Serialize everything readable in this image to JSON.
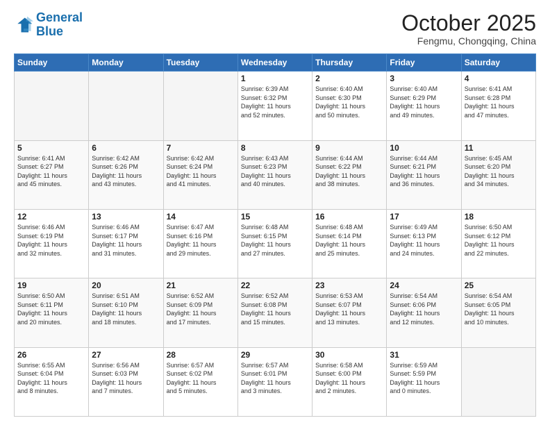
{
  "logo": {
    "line1": "General",
    "line2": "Blue"
  },
  "title": "October 2025",
  "subtitle": "Fengmu, Chongqing, China",
  "days_header": [
    "Sunday",
    "Monday",
    "Tuesday",
    "Wednesday",
    "Thursday",
    "Friday",
    "Saturday"
  ],
  "weeks": [
    [
      {
        "day": "",
        "info": ""
      },
      {
        "day": "",
        "info": ""
      },
      {
        "day": "",
        "info": ""
      },
      {
        "day": "1",
        "info": "Sunrise: 6:39 AM\nSunset: 6:32 PM\nDaylight: 11 hours\nand 52 minutes."
      },
      {
        "day": "2",
        "info": "Sunrise: 6:40 AM\nSunset: 6:30 PM\nDaylight: 11 hours\nand 50 minutes."
      },
      {
        "day": "3",
        "info": "Sunrise: 6:40 AM\nSunset: 6:29 PM\nDaylight: 11 hours\nand 49 minutes."
      },
      {
        "day": "4",
        "info": "Sunrise: 6:41 AM\nSunset: 6:28 PM\nDaylight: 11 hours\nand 47 minutes."
      }
    ],
    [
      {
        "day": "5",
        "info": "Sunrise: 6:41 AM\nSunset: 6:27 PM\nDaylight: 11 hours\nand 45 minutes."
      },
      {
        "day": "6",
        "info": "Sunrise: 6:42 AM\nSunset: 6:26 PM\nDaylight: 11 hours\nand 43 minutes."
      },
      {
        "day": "7",
        "info": "Sunrise: 6:42 AM\nSunset: 6:24 PM\nDaylight: 11 hours\nand 41 minutes."
      },
      {
        "day": "8",
        "info": "Sunrise: 6:43 AM\nSunset: 6:23 PM\nDaylight: 11 hours\nand 40 minutes."
      },
      {
        "day": "9",
        "info": "Sunrise: 6:44 AM\nSunset: 6:22 PM\nDaylight: 11 hours\nand 38 minutes."
      },
      {
        "day": "10",
        "info": "Sunrise: 6:44 AM\nSunset: 6:21 PM\nDaylight: 11 hours\nand 36 minutes."
      },
      {
        "day": "11",
        "info": "Sunrise: 6:45 AM\nSunset: 6:20 PM\nDaylight: 11 hours\nand 34 minutes."
      }
    ],
    [
      {
        "day": "12",
        "info": "Sunrise: 6:46 AM\nSunset: 6:19 PM\nDaylight: 11 hours\nand 32 minutes."
      },
      {
        "day": "13",
        "info": "Sunrise: 6:46 AM\nSunset: 6:17 PM\nDaylight: 11 hours\nand 31 minutes."
      },
      {
        "day": "14",
        "info": "Sunrise: 6:47 AM\nSunset: 6:16 PM\nDaylight: 11 hours\nand 29 minutes."
      },
      {
        "day": "15",
        "info": "Sunrise: 6:48 AM\nSunset: 6:15 PM\nDaylight: 11 hours\nand 27 minutes."
      },
      {
        "day": "16",
        "info": "Sunrise: 6:48 AM\nSunset: 6:14 PM\nDaylight: 11 hours\nand 25 minutes."
      },
      {
        "day": "17",
        "info": "Sunrise: 6:49 AM\nSunset: 6:13 PM\nDaylight: 11 hours\nand 24 minutes."
      },
      {
        "day": "18",
        "info": "Sunrise: 6:50 AM\nSunset: 6:12 PM\nDaylight: 11 hours\nand 22 minutes."
      }
    ],
    [
      {
        "day": "19",
        "info": "Sunrise: 6:50 AM\nSunset: 6:11 PM\nDaylight: 11 hours\nand 20 minutes."
      },
      {
        "day": "20",
        "info": "Sunrise: 6:51 AM\nSunset: 6:10 PM\nDaylight: 11 hours\nand 18 minutes."
      },
      {
        "day": "21",
        "info": "Sunrise: 6:52 AM\nSunset: 6:09 PM\nDaylight: 11 hours\nand 17 minutes."
      },
      {
        "day": "22",
        "info": "Sunrise: 6:52 AM\nSunset: 6:08 PM\nDaylight: 11 hours\nand 15 minutes."
      },
      {
        "day": "23",
        "info": "Sunrise: 6:53 AM\nSunset: 6:07 PM\nDaylight: 11 hours\nand 13 minutes."
      },
      {
        "day": "24",
        "info": "Sunrise: 6:54 AM\nSunset: 6:06 PM\nDaylight: 11 hours\nand 12 minutes."
      },
      {
        "day": "25",
        "info": "Sunrise: 6:54 AM\nSunset: 6:05 PM\nDaylight: 11 hours\nand 10 minutes."
      }
    ],
    [
      {
        "day": "26",
        "info": "Sunrise: 6:55 AM\nSunset: 6:04 PM\nDaylight: 11 hours\nand 8 minutes."
      },
      {
        "day": "27",
        "info": "Sunrise: 6:56 AM\nSunset: 6:03 PM\nDaylight: 11 hours\nand 7 minutes."
      },
      {
        "day": "28",
        "info": "Sunrise: 6:57 AM\nSunset: 6:02 PM\nDaylight: 11 hours\nand 5 minutes."
      },
      {
        "day": "29",
        "info": "Sunrise: 6:57 AM\nSunset: 6:01 PM\nDaylight: 11 hours\nand 3 minutes."
      },
      {
        "day": "30",
        "info": "Sunrise: 6:58 AM\nSunset: 6:00 PM\nDaylight: 11 hours\nand 2 minutes."
      },
      {
        "day": "31",
        "info": "Sunrise: 6:59 AM\nSunset: 5:59 PM\nDaylight: 11 hours\nand 0 minutes."
      },
      {
        "day": "",
        "info": ""
      }
    ]
  ]
}
